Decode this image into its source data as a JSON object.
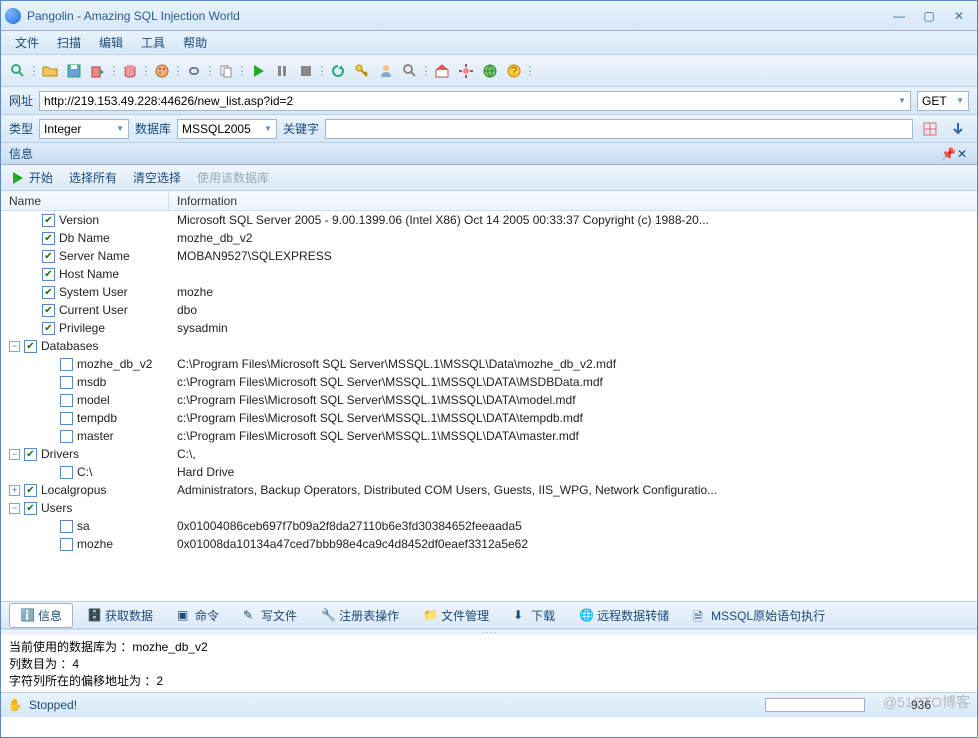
{
  "window": {
    "title": "Pangolin - Amazing SQL Injection World"
  },
  "menubar": {
    "file": "文件",
    "scan": "扫描",
    "edit": "编辑",
    "tools": "工具",
    "help": "帮助"
  },
  "urlrow": {
    "label": "网址",
    "url": "http://219.153.49.228:44626/new_list.asp?id=2",
    "method": "GET"
  },
  "typerow": {
    "type_label": "类型",
    "type_value": "Integer",
    "db_label": "数据库",
    "db_value": "MSSQL2005",
    "keyword_label": "关键字",
    "keyword_value": ""
  },
  "info_panel": {
    "title": "信息",
    "toolbar": {
      "start": "开始",
      "select_all": "选择所有",
      "clear": "清空选择",
      "use_db": "使用该数据库"
    },
    "header": {
      "name": "Name",
      "info": "Information"
    }
  },
  "tree": [
    {
      "depth": 1,
      "exp": "",
      "chk": true,
      "name": "Version",
      "info": "Microsoft SQL Server 2005 - 9.00.1399.06 (Intel X86) Oct 14 2005 00:33:37 Copyright (c) 1988-20..."
    },
    {
      "depth": 1,
      "exp": "",
      "chk": true,
      "name": "Db Name",
      "info": "mozhe_db_v2"
    },
    {
      "depth": 1,
      "exp": "",
      "chk": true,
      "name": "Server Name",
      "info": "MOBAN9527\\SQLEXPRESS"
    },
    {
      "depth": 1,
      "exp": "",
      "chk": true,
      "name": "Host Name",
      "info": ""
    },
    {
      "depth": 1,
      "exp": "",
      "chk": true,
      "name": "System User",
      "info": "mozhe"
    },
    {
      "depth": 1,
      "exp": "",
      "chk": true,
      "name": "Current User",
      "info": "dbo"
    },
    {
      "depth": 1,
      "exp": "",
      "chk": true,
      "name": "Privilege",
      "info": "sysadmin"
    },
    {
      "depth": 0,
      "exp": "-",
      "chk": true,
      "name": "Databases",
      "info": ""
    },
    {
      "depth": 2,
      "exp": "",
      "chk": false,
      "name": "mozhe_db_v2",
      "info": "C:\\Program Files\\Microsoft SQL Server\\MSSQL.1\\MSSQL\\Data\\mozhe_db_v2.mdf"
    },
    {
      "depth": 2,
      "exp": "",
      "chk": false,
      "name": "msdb",
      "info": "c:\\Program Files\\Microsoft SQL Server\\MSSQL.1\\MSSQL\\DATA\\MSDBData.mdf"
    },
    {
      "depth": 2,
      "exp": "",
      "chk": false,
      "name": "model",
      "info": "c:\\Program Files\\Microsoft SQL Server\\MSSQL.1\\MSSQL\\DATA\\model.mdf"
    },
    {
      "depth": 2,
      "exp": "",
      "chk": false,
      "name": "tempdb",
      "info": "c:\\Program Files\\Microsoft SQL Server\\MSSQL.1\\MSSQL\\DATA\\tempdb.mdf"
    },
    {
      "depth": 2,
      "exp": "",
      "chk": false,
      "name": "master",
      "info": "c:\\Program Files\\Microsoft SQL Server\\MSSQL.1\\MSSQL\\DATA\\master.mdf"
    },
    {
      "depth": 0,
      "exp": "-",
      "chk": true,
      "name": "Drivers",
      "info": "C:\\,"
    },
    {
      "depth": 2,
      "exp": "",
      "chk": false,
      "name": "C:\\",
      "info": "Hard Drive"
    },
    {
      "depth": 0,
      "exp": "+",
      "chk": true,
      "name": "Localgropus",
      "info": "Administrators, Backup Operators, Distributed COM Users, Guests, IIS_WPG, Network Configuratio..."
    },
    {
      "depth": 0,
      "exp": "-",
      "chk": true,
      "name": "Users",
      "info": ""
    },
    {
      "depth": 2,
      "exp": "",
      "chk": false,
      "name": "sa",
      "info": "0x01004086ceb697f7b09a2f8da27110b6e3fd30384652feeaada5"
    },
    {
      "depth": 2,
      "exp": "",
      "chk": false,
      "name": "mozhe",
      "info": "0x01008da10134a47ced7bbb98e4ca9c4d8452df0eaef3312a5e62"
    }
  ],
  "bottom_tabs": {
    "info": "信息",
    "fetch": "获取数据",
    "cmd": "命令",
    "write": "写文件",
    "reg": "注册表操作",
    "filemgr": "文件管理",
    "download": "下载",
    "remote": "远程数据转储",
    "rawsql": "MSSQL原始语句执行"
  },
  "output": {
    "line1": "当前使用的数据库为 ：mozhe_db_v2",
    "line2": "列数目为 ：4",
    "line3": "字符列所在的偏移地址为 ：2"
  },
  "status": {
    "text": "Stopped!",
    "number": "936"
  },
  "watermark": "@51CTO博客"
}
